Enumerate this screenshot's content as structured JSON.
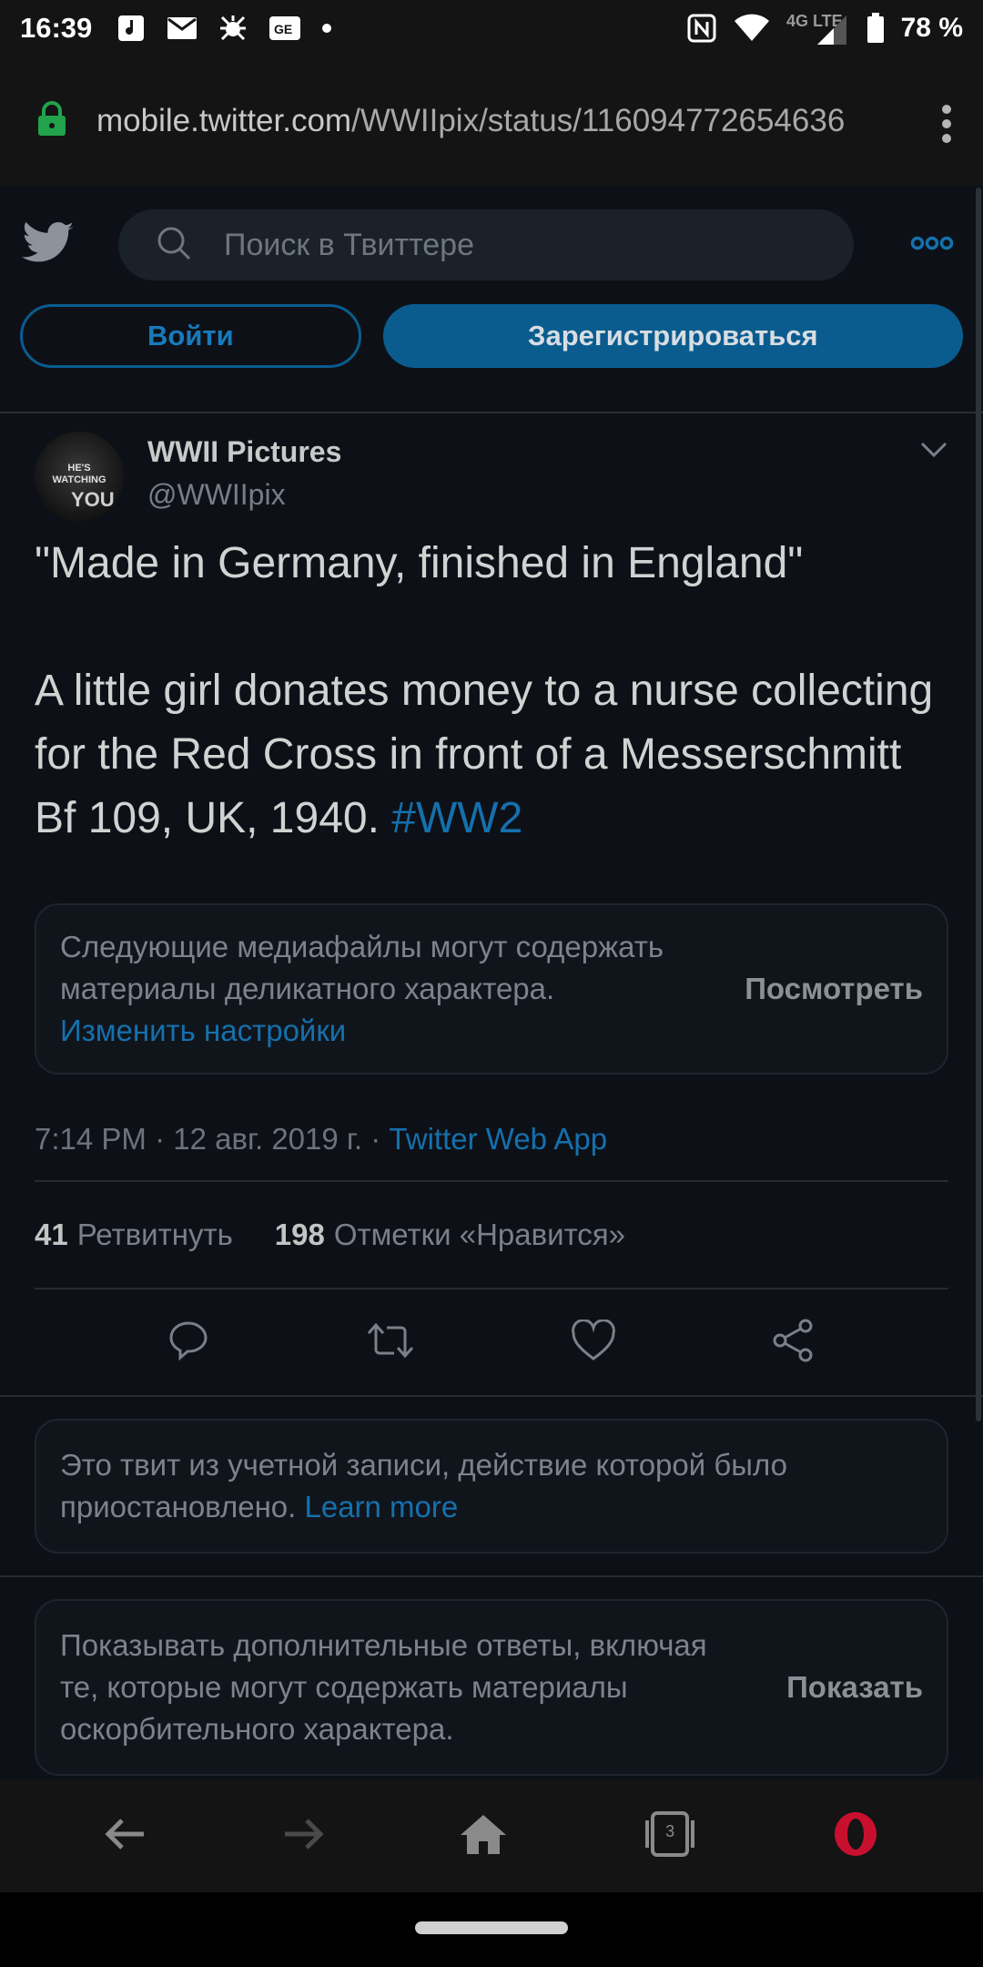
{
  "status_bar": {
    "time": "16:39",
    "network": "4G LTE",
    "battery": "78 %"
  },
  "browser": {
    "url_host": "mobile.twitter.com",
    "url_path": "/WWIIpix/status/116094772654636"
  },
  "twitter": {
    "search_placeholder": "Поиск в Твиттере",
    "login_label": "Войти",
    "signup_label": "Зарегистрироваться"
  },
  "tweet": {
    "display_name": "WWII Pictures",
    "handle": "@WWIIpix",
    "avatar_text": "HE'S WATCHING",
    "avatar_text2": "YOU",
    "paragraph1": "\"Made in Germany, finished in England\"",
    "paragraph2": "A little girl donates money to a nurse collecting for the Red Cross in front of a Messerschmitt Bf 109, UK, 1940.",
    "hashtag": "#WW2",
    "sensitive_text": "Следующие медиафайлы могут содержать материалы деликатного характера.",
    "sensitive_link": "Изменить настройки",
    "view_label": "Посмотреть",
    "timestamp": "7:14 PM · 12 авг. 2019 г. ·",
    "source": "Twitter Web App",
    "retweets_count": "41",
    "retweets_label": "Ретвитнуть",
    "likes_count": "198",
    "likes_label": "Отметки «Нравится»"
  },
  "suspended_card": {
    "text": "Это твит из учетной записи, действие которой было приостановлено.",
    "link": "Learn more"
  },
  "replies_card": {
    "text": "Показывать дополнительные ответы, включая те, которые могут содержать материалы оскорбительного характера.",
    "show_label": "Показать"
  },
  "bottom_bar": {
    "tabs_count": "3"
  },
  "colors": {
    "twitter_blue": "#1570ad",
    "background": "#0d1117",
    "opera_red": "#c8102e"
  }
}
